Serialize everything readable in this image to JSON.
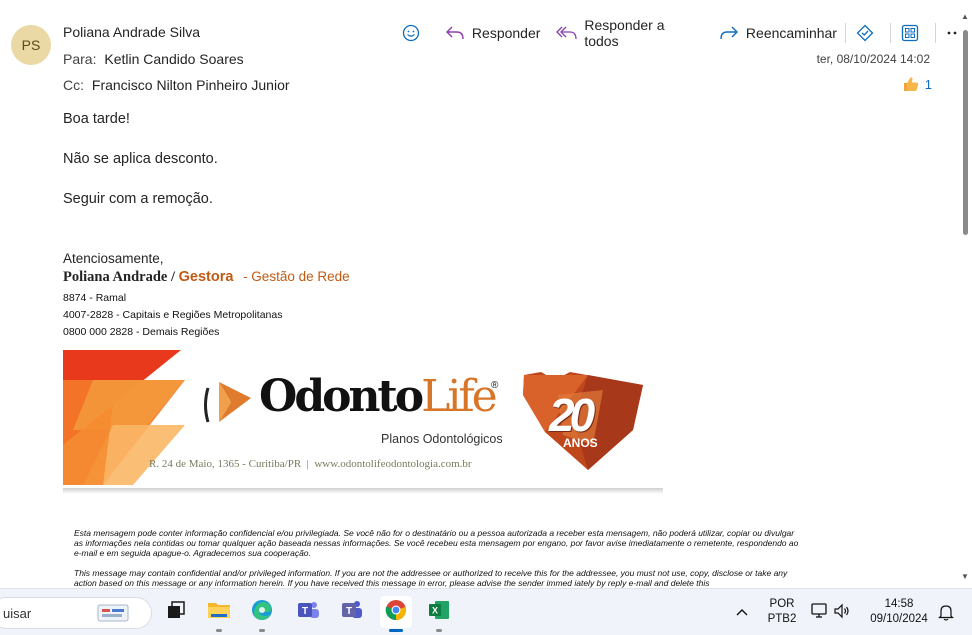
{
  "message": {
    "avatar_initials": "PS",
    "sender": "Poliana Andrade Silva",
    "to_label": "Para:",
    "to": "Ketlin Candido Soares",
    "cc_label": "Cc:",
    "cc": "Francisco Nilton Pinheiro Junior",
    "date": "ter, 08/10/2024 14:02",
    "reaction_count": "1",
    "body": [
      "Boa tarde!",
      "Não se aplica desconto.",
      "Seguir com a remoção."
    ]
  },
  "toolbar": {
    "reply": "Responder",
    "reply_all": "Responder a todos",
    "forward": "Reencaminhar"
  },
  "signature": {
    "closing": "Atenciosamente,",
    "name": "Poliana Andrade /",
    "role": "Gestora",
    "dept": "- Gestão de Rede",
    "line1": "8874 - Ramal",
    "line2": "4007-2828 - Capitais e Regiões Metropolitanas",
    "line3": "0800 000 2828 - Demais Regiões"
  },
  "banner": {
    "logo_part1": "Odonto",
    "logo_part2": "Life",
    "registered": "®",
    "tagline": "Planos Odontológicos",
    "address": "R. 24 de Maio, 1365 - Curitiba/PR  |  www.odontolifeodontologia.com.br",
    "anniversary_number": "20",
    "anniversary_word": "ANOS"
  },
  "disclaimer": {
    "pt": "Esta mensagem pode conter informação confidencial e/ou privilegiada. Se você não for o destinatário ou a pessoa autorizada a receber esta mensagem, não poderá utilizar, copiar ou divulgar as informações nela contidas ou tomar qualquer ação baseada nessas informações. Se você recebeu esta mensagem por engano, por favor avise imediatamente o remetente, respondendo ao e-mail e em seguida apague-o.  Agradecemos sua cooperação.",
    "en": "This message may contain confidential and/or privileged information. If you are not the addressee or authorized to receive this for the addressee, you must not use, copy, disclose or take any action based on this message or any information herein. If you have received this message in error, please advise the sender immed iately by reply e-mail and delete this"
  },
  "taskbar": {
    "search_text": "uisar",
    "language_line1": "POR",
    "language_line2": "PTB2",
    "time": "14:58",
    "date": "09/10/2024"
  },
  "colors": {
    "accent": "#0f6cbd",
    "brand_orange": "#c05a14",
    "avatar_bg": "#ead9a5"
  }
}
